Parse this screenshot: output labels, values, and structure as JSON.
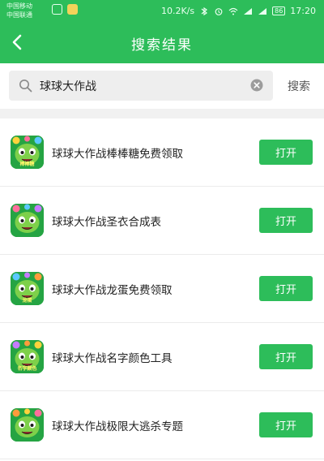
{
  "status_bar": {
    "carrier_1": "中国移动",
    "carrier_2": "中国联通",
    "network_speed": "10.2K/s",
    "battery": "86",
    "time": "17:20"
  },
  "header": {
    "title": "搜索结果"
  },
  "search": {
    "value": "球球大作战",
    "button_label": "搜索"
  },
  "results": [
    {
      "title": "球球大作战棒棒糖免费领取",
      "button_label": "打开",
      "icon_caption": "棒棒糖"
    },
    {
      "title": "球球大作战圣衣合成表",
      "button_label": "打开",
      "icon_caption": ""
    },
    {
      "title": "球球大作战龙蛋免费领取",
      "button_label": "打开",
      "icon_caption": "龙蛋"
    },
    {
      "title": "球球大作战名字颜色工具",
      "button_label": "打开",
      "icon_caption": "名字颜色"
    },
    {
      "title": "球球大作战极限大逃杀专题",
      "button_label": "打开",
      "icon_caption": ""
    }
  ],
  "colors": {
    "brand_green": "#2dbd5a",
    "separator": "#f1f1f1"
  }
}
